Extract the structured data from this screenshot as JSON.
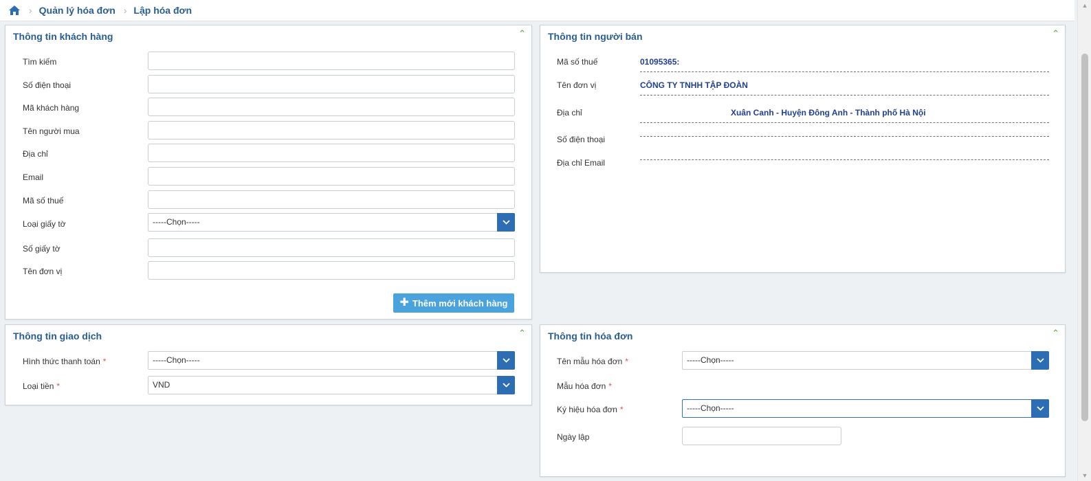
{
  "breadcrumb": {
    "item1": "Quản lý hóa đơn",
    "item2": "Lập hóa đơn"
  },
  "customer": {
    "title": "Thông tin khách hàng",
    "search": "Tìm kiếm",
    "phone": "Số điện thoại",
    "code": "Mã khách hàng",
    "buyer": "Tên người mua",
    "address": "Địa chỉ",
    "email": "Email",
    "tax": "Mã số thuế",
    "doc_type": "Loại giấy tờ",
    "doc_type_value": "-----Chọn-----",
    "doc_no": "Số giấy tờ",
    "unit": "Tên đơn vị",
    "add_button": "Thêm mới khách hàng"
  },
  "seller": {
    "title": "Thông tin người bán",
    "tax_label": "Mã số thuế",
    "tax_value": "01095365:",
    "unit_label": "Tên đơn vị",
    "unit_value": "CÔNG TY TNHH TẬP ĐOÀN",
    "address_label": "Địa chỉ",
    "address_value": "Xuân Canh - Huyện Đông Anh - Thành phố Hà Nội",
    "phone_label": "Số điện thoại",
    "email_label": "Địa chỉ Email"
  },
  "transaction": {
    "title": "Thông tin giao dịch",
    "payment_label": "Hình thức thanh toán",
    "payment_value": "-----Chọn-----",
    "currency_label": "Loại tiền",
    "currency_value": "VND"
  },
  "invoice": {
    "title": "Thông tin hóa đơn",
    "template_name_label": "Tên mẫu hóa đơn",
    "template_name_value": "-----Chọn-----",
    "template_label": "Mẫu hóa đơn",
    "symbol_label": "Ký hiệu hóa đơn",
    "symbol_value": "-----Chọn-----",
    "date_label": "Ngày lập"
  },
  "required_mark": "*",
  "colors": {
    "accent": "#2c6db3",
    "title": "#2a5d8f",
    "add_button": "#4aa3dc"
  }
}
